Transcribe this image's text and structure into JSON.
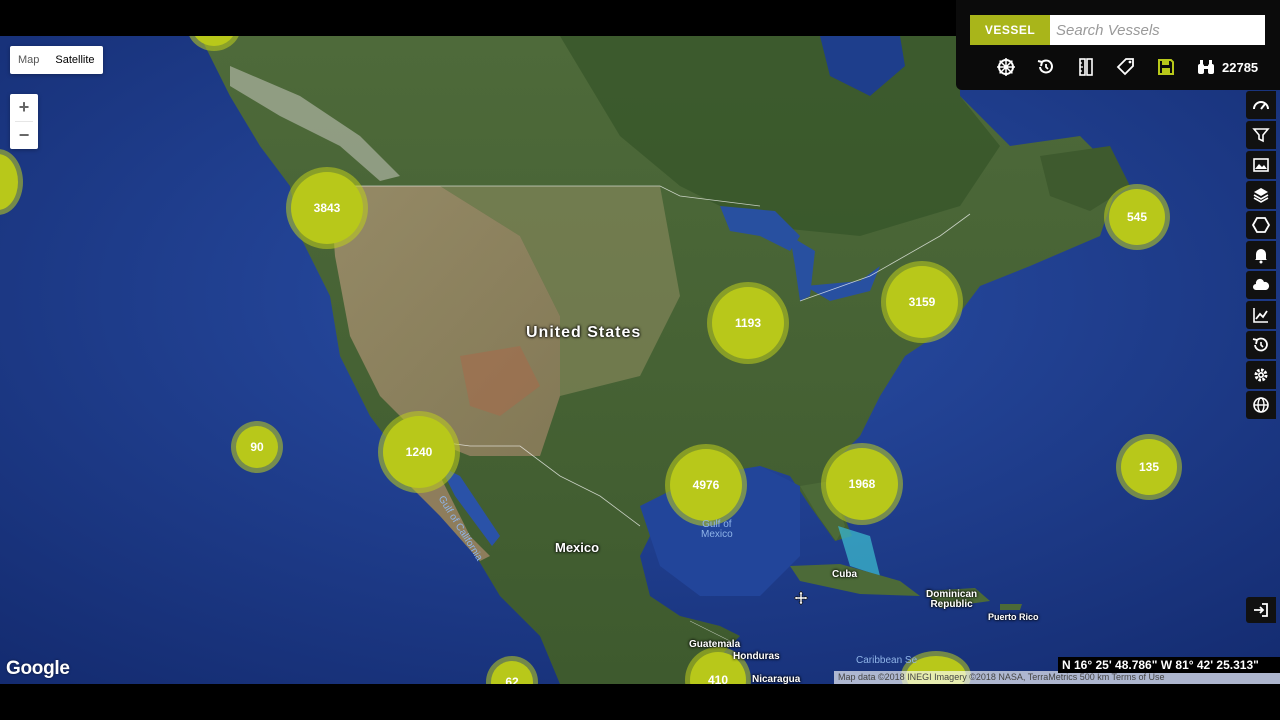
{
  "map_type": {
    "map_label": "Map",
    "satellite_label": "Satellite",
    "active": "Satellite"
  },
  "zoom": {
    "in_label": "+",
    "out_label": "−"
  },
  "vessel_panel": {
    "vessel_button_label": "VESSEL",
    "search_placeholder": "Search Vessels",
    "vessel_count": "22785",
    "toolbar_icons": [
      "ship-wheel-icon",
      "history-icon",
      "ruler-icon",
      "tags-icon",
      "save-icon",
      "binoculars-icon"
    ],
    "accent_color": "#a9b51a"
  },
  "sidebar_icons": [
    "speedometer-icon",
    "filter-icon",
    "image-icon",
    "layers-icon",
    "hexagon-icon",
    "bell-icon",
    "cloud-icon",
    "chart-icon",
    "history-icon",
    "settings-icon",
    "globe-icon"
  ],
  "clusters": [
    "3843",
    "545",
    "3159",
    "1193",
    "90",
    "1240",
    "4976",
    "1968",
    "135",
    "62",
    "410"
  ],
  "labels": {
    "united_states": "United States",
    "mexico": "Mexico",
    "cuba": "Cuba",
    "dominican_republic": "Dominican\nRepublic",
    "puerto_rico": "Puerto Rico",
    "guatemala": "Guatemala",
    "honduras": "Honduras",
    "nicaragua": "Nicaragua",
    "gulf_of_mexico": "Gulf of\nMexico",
    "gulf_of_california": "Gulf of California",
    "caribbean_sea": "Caribbean Se"
  },
  "google_logo": "Google",
  "attribution": "Map data ©2018 INEGI Imagery ©2018 NASA, TerraMetrics   500 km        Terms of Use",
  "coordinates": "N 16° 25' 48.786\" W 81° 42' 25.313\"",
  "cluster_color": "#b8c81a"
}
